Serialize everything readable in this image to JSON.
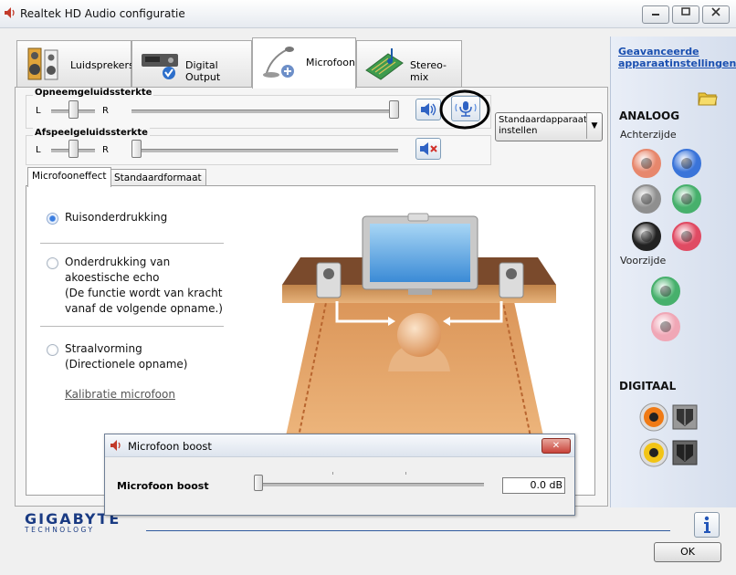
{
  "window": {
    "title": "Realtek HD Audio configuratie",
    "buttons": [
      "minimize",
      "maximize",
      "close"
    ]
  },
  "device_tabs": [
    {
      "label": "Luidsprekers",
      "icon": "speakers-icon",
      "selected": false
    },
    {
      "label": "Digital Output",
      "icon": "digital-output-icon",
      "selected": false
    },
    {
      "label": "Microfoon",
      "icon": "microphone-icon",
      "selected": true
    },
    {
      "label": "Stereo-mix",
      "icon": "stereo-mix-icon",
      "selected": false
    }
  ],
  "recording_volume": {
    "label": "Opneemgeluidssterkte",
    "left": "L",
    "right": "R",
    "balance": 0.5,
    "level": 1.0
  },
  "playback_volume": {
    "label": "Afspeelgeluidssterkte",
    "left": "L",
    "right": "R",
    "balance": 0.5,
    "level": 0.0,
    "muted": true
  },
  "default_device_button": {
    "line1": "Standaardapparaat",
    "line2": "instellen"
  },
  "inner_tabs": [
    {
      "label": "Microfooneffect",
      "selected": true
    },
    {
      "label": "Standaardformaat",
      "selected": false
    }
  ],
  "effects": {
    "noise_suppression": {
      "label": "Ruisonderdrukking",
      "checked": true
    },
    "echo_cancellation": {
      "label_lines": [
        "Onderdrukking van",
        "akoestische echo",
        "(De functie wordt van kracht",
        "vanaf de volgende opname.)"
      ],
      "checked": false
    },
    "beamforming": {
      "label_lines": [
        "Straalvorming",
        "(Directionele opname)"
      ],
      "checked": false
    },
    "calibrate_link": "Kalibratie microfoon"
  },
  "right_panel": {
    "advanced_link_lines": [
      "Geavanceerde",
      "apparaatinstellingen"
    ],
    "analog_title": "ANALOOG",
    "back_label": "Achterzijde",
    "front_label": "Voorzijde",
    "digital_title": "DIGITAAL",
    "colors": {
      "back_jacks": [
        "#e7876c",
        "#3a74d9",
        "#8f8f8f",
        "#47b06c",
        "#222222",
        "#e04b63"
      ],
      "front_jacks": [
        "#47b06c",
        "#f0a7b6"
      ],
      "coax_ring": "#f07a14",
      "coax_ring_2": "#f2c414"
    }
  },
  "footer": {
    "brand": "GIGABYTE",
    "brand_sub": "TECHNOLOGY",
    "ok_label": "OK"
  },
  "boost_dialog": {
    "title": "Microfoon boost",
    "label": "Microfoon boost",
    "value": "0.0 dB",
    "level": 0.0,
    "close_glyph": "✕"
  }
}
